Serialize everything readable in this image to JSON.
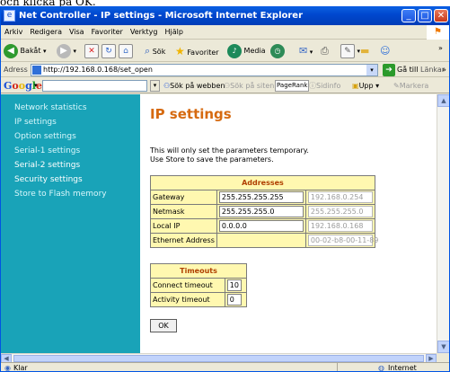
{
  "caption_text": "och klicka på OK.",
  "window": {
    "title": "Net Controller - IP settings - Microsoft Internet Explorer",
    "minimize": "_",
    "maximize": "□",
    "close": "✕"
  },
  "menubar": [
    "Arkiv",
    "Redigera",
    "Visa",
    "Favoriter",
    "Verktyg",
    "Hjälp"
  ],
  "toolbar": {
    "back_label": "Bakåt",
    "search_label": "Sök",
    "favorites_label": "Favoriter",
    "media_label": "Media",
    "overflow": "»"
  },
  "addressbar": {
    "label": "Adress",
    "url": "http://192.168.0.168/set_open",
    "go_label": "Gå till",
    "links_label": "Länkar"
  },
  "googlebar": {
    "logo": "Google",
    "search_web_label": "Sök på webben",
    "search_site_label": "Sök på siten",
    "pagerank_label": "PageRank",
    "info_label": "Sidinfo",
    "up_label": "Upp",
    "highlight_label": "Markera"
  },
  "sidebar": {
    "items": [
      {
        "label": "Network statistics"
      },
      {
        "label": "IP settings"
      },
      {
        "label": "Option settings"
      },
      {
        "label": "Serial-1 settings"
      },
      {
        "label": "Serial-2 settings"
      },
      {
        "label": "Security settings"
      },
      {
        "label": "Store to Flash memory"
      }
    ]
  },
  "main": {
    "title": "IP settings",
    "info_line1": "This will only set the parameters temporary.",
    "info_line2": "Use Store to save the parameters.",
    "addresses": {
      "header": "Addresses",
      "rows": [
        {
          "label": "Gateway",
          "value": "255.255.255.255",
          "current": "192.168.0.254"
        },
        {
          "label": "Netmask",
          "value": "255.255.255.0",
          "current": "255.255.255.0"
        },
        {
          "label": "Local IP",
          "value": "0.0.0.0",
          "current": "192.168.0.168"
        },
        {
          "label": "Ethernet Address",
          "value": "",
          "current": "00-02-b8-00-11-89"
        }
      ]
    },
    "timeouts": {
      "header": "Timeouts",
      "rows": [
        {
          "label": "Connect timeout",
          "value": "10"
        },
        {
          "label": "Activity timeout",
          "value": "0"
        }
      ]
    },
    "ok_label": "OK"
  },
  "statusbar": {
    "status": "Klar",
    "zone": "Internet"
  }
}
